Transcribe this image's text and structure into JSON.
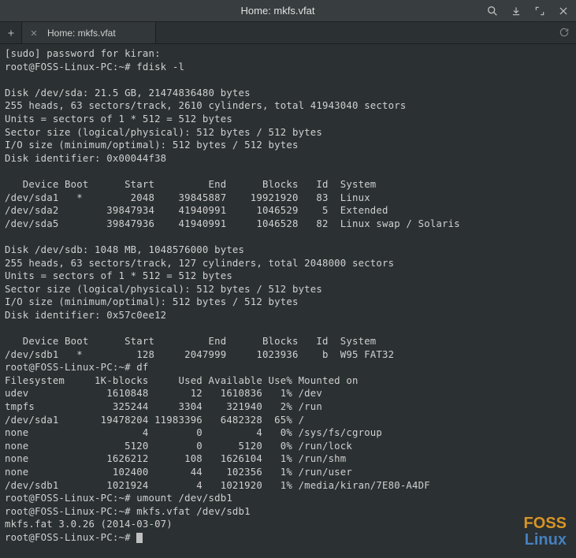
{
  "titlebar": {
    "title": "Home: mkfs.vfat"
  },
  "tabs": {
    "active_label": "Home: mkfs.vfat"
  },
  "terminal": {
    "lines": [
      "[sudo] password for kiran:",
      "root@FOSS-Linux-PC:~# fdisk -l",
      "",
      "Disk /dev/sda: 21.5 GB, 21474836480 bytes",
      "255 heads, 63 sectors/track, 2610 cylinders, total 41943040 sectors",
      "Units = sectors of 1 * 512 = 512 bytes",
      "Sector size (logical/physical): 512 bytes / 512 bytes",
      "I/O size (minimum/optimal): 512 bytes / 512 bytes",
      "Disk identifier: 0x00044f38",
      "",
      "   Device Boot      Start         End      Blocks   Id  System",
      "/dev/sda1   *        2048    39845887    19921920   83  Linux",
      "/dev/sda2        39847934    41940991     1046529    5  Extended",
      "/dev/sda5        39847936    41940991     1046528   82  Linux swap / Solaris",
      "",
      "Disk /dev/sdb: 1048 MB, 1048576000 bytes",
      "255 heads, 63 sectors/track, 127 cylinders, total 2048000 sectors",
      "Units = sectors of 1 * 512 = 512 bytes",
      "Sector size (logical/physical): 512 bytes / 512 bytes",
      "I/O size (minimum/optimal): 512 bytes / 512 bytes",
      "Disk identifier: 0x57c0ee12",
      "",
      "   Device Boot      Start         End      Blocks   Id  System",
      "/dev/sdb1   *         128     2047999     1023936    b  W95 FAT32",
      "root@FOSS-Linux-PC:~# df",
      "Filesystem     1K-blocks     Used Available Use% Mounted on",
      "udev             1610848       12   1610836   1% /dev",
      "tmpfs             325244     3304    321940   2% /run",
      "/dev/sda1       19478204 11983396   6482328  65% /",
      "none                   4        0         4   0% /sys/fs/cgroup",
      "none                5120        0      5120   0% /run/lock",
      "none             1626212      108   1626104   1% /run/shm",
      "none              102400       44    102356   1% /run/user",
      "/dev/sdb1        1021924        4   1021920   1% /media/kiran/7E80-A4DF",
      "root@FOSS-Linux-PC:~# umount /dev/sdb1",
      "root@FOSS-Linux-PC:~# mkfs.vfat /dev/sdb1",
      "mkfs.fat 3.0.26 (2014-03-07)",
      "root@FOSS-Linux-PC:~# "
    ]
  },
  "watermark": {
    "line1": "FOSS",
    "line2": "Linux"
  }
}
